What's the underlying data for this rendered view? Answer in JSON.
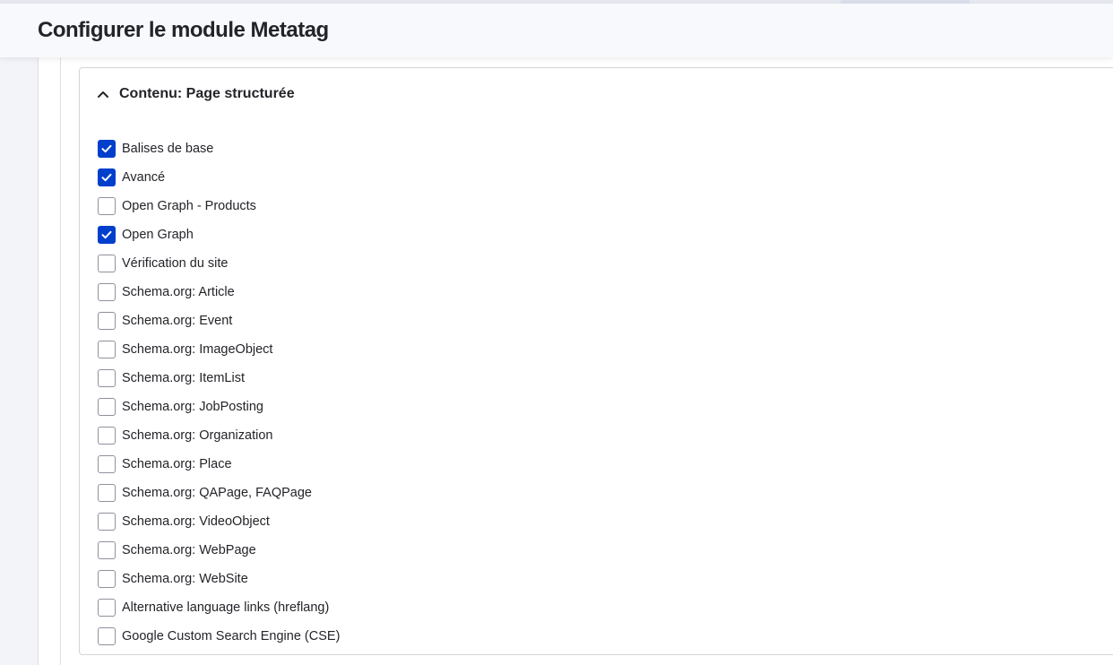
{
  "header": {
    "title": "Configurer le module Metatag"
  },
  "section": {
    "summary": "Contenu: Page structurée",
    "expanded": true,
    "icon": "chevron-up-icon"
  },
  "colors": {
    "accent": "#003ecc",
    "text": "#232429",
    "background": "#f3f4f9"
  },
  "options": [
    {
      "label": "Balises de base",
      "checked": true
    },
    {
      "label": "Avancé",
      "checked": true
    },
    {
      "label": "Open Graph - Products",
      "checked": false
    },
    {
      "label": "Open Graph",
      "checked": true
    },
    {
      "label": "Vérification du site",
      "checked": false
    },
    {
      "label": "Schema.org: Article",
      "checked": false
    },
    {
      "label": "Schema.org: Event",
      "checked": false
    },
    {
      "label": "Schema.org: ImageObject",
      "checked": false
    },
    {
      "label": "Schema.org: ItemList",
      "checked": false
    },
    {
      "label": "Schema.org: JobPosting",
      "checked": false
    },
    {
      "label": "Schema.org: Organization",
      "checked": false
    },
    {
      "label": "Schema.org: Place",
      "checked": false
    },
    {
      "label": "Schema.org: QAPage, FAQPage",
      "checked": false
    },
    {
      "label": "Schema.org: VideoObject",
      "checked": false
    },
    {
      "label": "Schema.org: WebPage",
      "checked": false
    },
    {
      "label": "Schema.org: WebSite",
      "checked": false
    },
    {
      "label": "Alternative language links (hreflang)",
      "checked": false
    },
    {
      "label": "Google Custom Search Engine (CSE)",
      "checked": false
    }
  ]
}
